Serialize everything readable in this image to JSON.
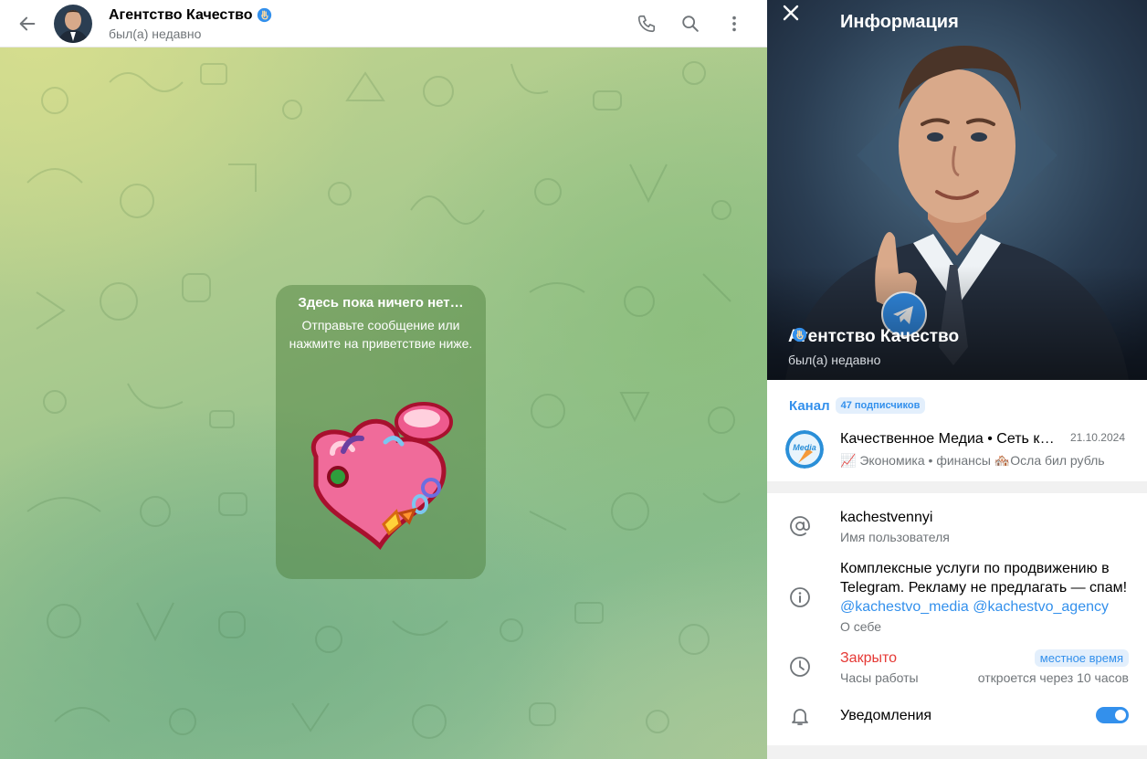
{
  "chat": {
    "title": "Агентство Качество",
    "status": "был(а) недавно",
    "empty_title": "Здесь пока ничего нет…",
    "empty_text": "Отправьте сообщение или нажмите на приветствие ниже.",
    "sticker": "heart-shaped-flower-sticker"
  },
  "info": {
    "panel_title": "Информация",
    "name": "Агентство Качество",
    "status": "был(а) недавно",
    "channel": {
      "label": "Канал",
      "subscribers": "47 подписчиков",
      "title": "Качественное Медиа • Сеть каналов",
      "date": "21.10.2024",
      "preview": "📈 Экономика • финансы 🏘️Осла бил рубль",
      "avatar_text": "Media"
    },
    "username": {
      "value": "kachestvennyi",
      "label": "Имя пользователя"
    },
    "bio": {
      "line1": "Комплексные услуги по продвижению в",
      "line2": "Telegram. Рекламу не предлагать — спам!",
      "link1": "@kachestvo_media",
      "link2": "@kachestvo_agency",
      "label": "О себе"
    },
    "hours": {
      "status": "Закрыто",
      "badge": "местное время",
      "label": "Часы работы",
      "opens": "откроется через 10 часов"
    },
    "notifications": {
      "label": "Уведомления",
      "enabled": true
    }
  },
  "colors": {
    "accent": "#3390ec",
    "closed": "#e53935",
    "muted": "#707579"
  }
}
